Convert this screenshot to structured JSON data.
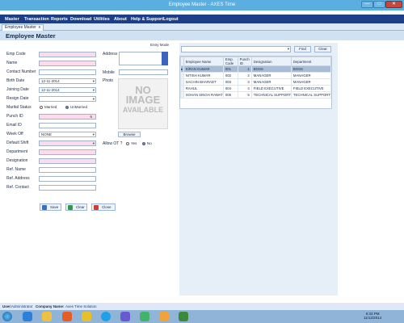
{
  "window": {
    "title": "Employee Master - AXES Time",
    "min": "—",
    "max": "□",
    "close": "✕"
  },
  "menu": [
    "Master",
    "Transaction",
    "Reports",
    "Download",
    "Utilities",
    "About",
    "Help & Support",
    "Logout"
  ],
  "tab": {
    "label": "Employee Master",
    "close": "x"
  },
  "page": {
    "title": "Employee Master",
    "entry_mode": "Entry Mode"
  },
  "form": {
    "emp_code_label": "Emp Code",
    "name_label": "Name",
    "contact_number_label": "Contact Number",
    "birth_date_label": "Birth Date",
    "birth_date_value": "12-11-2014",
    "joining_date_label": "Joining Date",
    "joining_date_value": "12-11-2014",
    "resign_date_label": "Resign Date",
    "marital_status_label": "Marital Status",
    "married_label": "Married",
    "unmarried_label": "UnMarried",
    "punch_id_label": "Punch ID",
    "punch_id_value": "6",
    "email_id_label": "Email ID",
    "week_off_label": "Week Off",
    "week_off_value": "NONE",
    "default_shift_label": "Default Shift",
    "department_label": "Department",
    "designation_label": "Designation",
    "ref_name_label": "Ref. Name",
    "ref_address_label": "Ref. Address",
    "ref_contact_label": "Ref. Contact",
    "address_label": "Address",
    "mobile_label": "Mobile",
    "photo_label": "Photo",
    "no_image_line1": "NO",
    "no_image_line2": "IMAGE",
    "no_image_line3": "AVAILABLE",
    "browse_label": "Browse",
    "allow_ot_label": "Allow OT ?",
    "yes_label": "Yes",
    "no_label": "No",
    "save_label": "Save",
    "clear_label": "Clear",
    "close_label": "Close"
  },
  "search": {
    "find_label": "Find",
    "clear_label": "Clear"
  },
  "table": {
    "columns": [
      "Employee Name",
      "Emp. Code",
      "Punch ID",
      "Designation",
      "Department"
    ],
    "rows": [
      {
        "name": "KIRAN KUMAR",
        "code": "001",
        "punch": "1",
        "designation": "BOSS",
        "department": "BOSS"
      },
      {
        "name": "NITISH KUMAR",
        "code": "002",
        "punch": "2",
        "designation": "MANAGER",
        "department": "MANAGER"
      },
      {
        "name": "SACHIN BHARADT",
        "code": "003",
        "punch": "3",
        "designation": "MANAGER",
        "department": "MANAGER"
      },
      {
        "name": "RAHUL",
        "code": "004",
        "punch": "4",
        "designation": "FIELD EXECUTIVE",
        "department": "FIELD EXECUTIVE"
      },
      {
        "name": "SOHAN SINGH RAWAT",
        "code": "005",
        "punch": "5",
        "designation": "TECHNICAL SUPPORT",
        "department": "TECHNICAL SUPPORT"
      }
    ]
  },
  "status": {
    "user_label": "User:",
    "user_value": "Administrator",
    "company_label": "Company Name:",
    "company_value": "Axes Time Solution"
  },
  "taskbar": {
    "time": "6:33 PM",
    "date": "11/12/2014"
  },
  "colors": {
    "menu_bg": "#1d3f87",
    "title_bar": "#5aaee0",
    "required_field": "#fbdcef",
    "selected_row": "#a9bcd6"
  }
}
